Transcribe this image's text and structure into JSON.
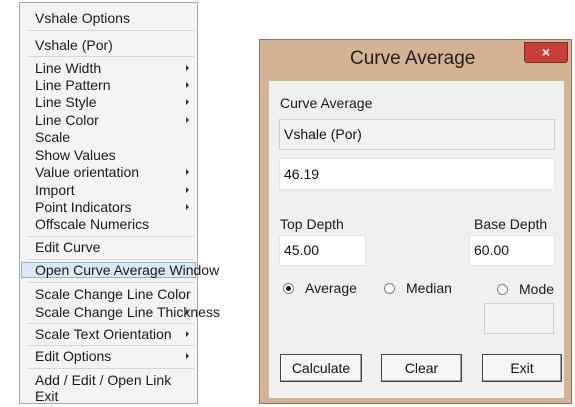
{
  "menu": {
    "items": [
      {
        "label": "Vshale Options",
        "has_submenu": false
      },
      {
        "label": "Vshale (Por)",
        "has_submenu": false
      },
      {
        "label": "Line Width",
        "has_submenu": true
      },
      {
        "label": "Line Pattern",
        "has_submenu": true
      },
      {
        "label": "Line Style",
        "has_submenu": true
      },
      {
        "label": "Line Color",
        "has_submenu": true
      },
      {
        "label": "Scale",
        "has_submenu": false
      },
      {
        "label": "Show Values",
        "has_submenu": false
      },
      {
        "label": "Value orientation",
        "has_submenu": true
      },
      {
        "label": "Import",
        "has_submenu": true
      },
      {
        "label": "Point Indicators",
        "has_submenu": true
      },
      {
        "label": "Offscale Numerics",
        "has_submenu": false
      },
      {
        "label": "Edit Curve",
        "has_submenu": false
      },
      {
        "label": "Open Curve Average Window",
        "has_submenu": false,
        "highlighted": true
      },
      {
        "label": "Scale Change Line Color",
        "has_submenu": false
      },
      {
        "label": "Scale Change Line Thickness",
        "has_submenu": true
      },
      {
        "label": "Scale Text Orientation",
        "has_submenu": true
      },
      {
        "label": "Edit Options",
        "has_submenu": true
      },
      {
        "label": "Add / Edit / Open Link",
        "has_submenu": false
      },
      {
        "label": "Exit",
        "has_submenu": false
      }
    ]
  },
  "dialog": {
    "title": "Curve Average",
    "close_glyph": "×",
    "curve_average_label": "Curve Average",
    "curve_name": "Vshale (Por)",
    "average_value": "46.19",
    "top_depth_label": "Top Depth",
    "top_depth_value": "45.00",
    "base_depth_label": "Base Depth",
    "base_depth_value": "60.00",
    "method_options": [
      {
        "label": "Average",
        "selected": true
      },
      {
        "label": "Median",
        "selected": false
      },
      {
        "label": "Mode",
        "selected": false
      }
    ],
    "mode_value": "",
    "buttons": {
      "calculate": "Calculate",
      "clear": "Clear",
      "exit": "Exit"
    }
  },
  "colors": {
    "dialog_frame": "#d3b394",
    "close_button": "#c8403a",
    "menu_highlight": "#dde8f5"
  }
}
